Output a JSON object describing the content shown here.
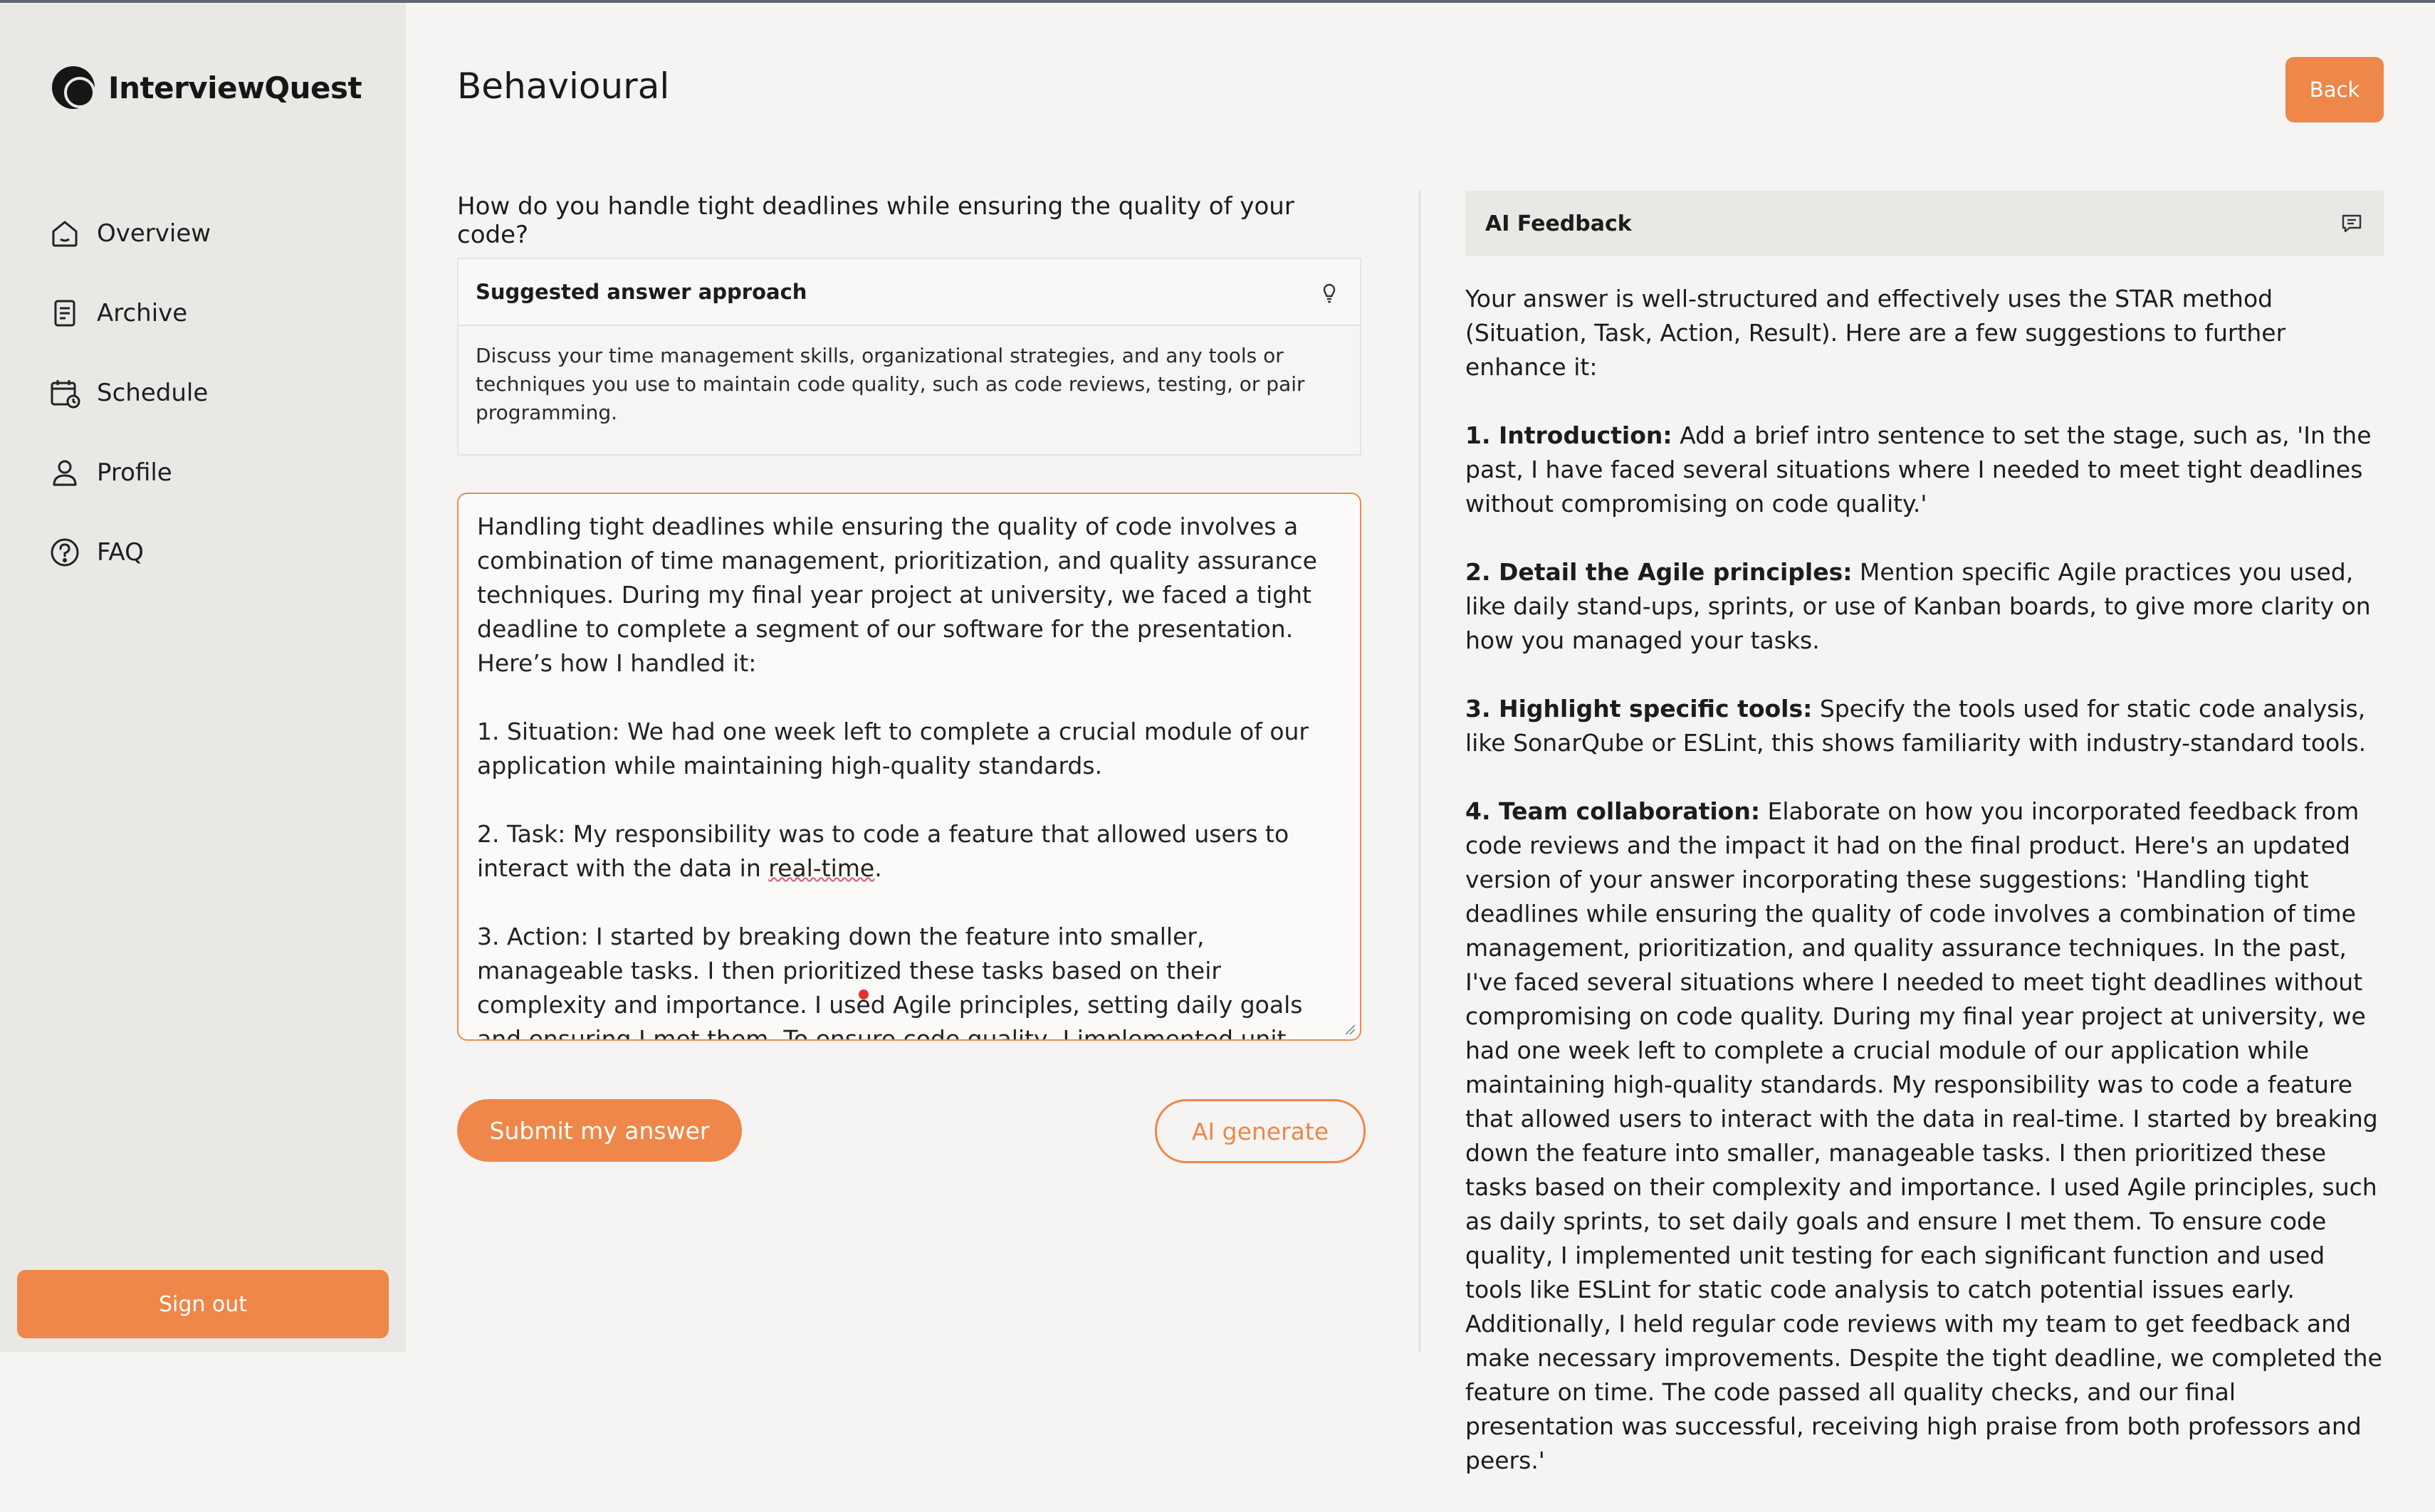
{
  "app": {
    "name": "InterviewQuest"
  },
  "sidebar": {
    "items": [
      {
        "label": "Overview",
        "icon": "home-icon"
      },
      {
        "label": "Archive",
        "icon": "document-icon"
      },
      {
        "label": "Schedule",
        "icon": "calendar-icon"
      },
      {
        "label": "Profile",
        "icon": "user-icon"
      },
      {
        "label": "FAQ",
        "icon": "help-circle-icon"
      }
    ],
    "signout_label": "Sign out"
  },
  "header": {
    "title": "Behavioural",
    "back_label": "Back"
  },
  "question": {
    "text": "How do you handle tight deadlines while ensuring the quality of your code?"
  },
  "approach": {
    "title": "Suggested answer approach",
    "text": "Discuss your time management skills, organizational strategies, and any tools or techniques you use to maintain code quality, such as code reviews, testing, or pair programming."
  },
  "answer": {
    "para1": "Handling tight deadlines while ensuring the quality of code involves a combination of time management, prioritization, and quality assurance techniques. During my final year project at university, we faced a tight deadline to complete a segment of our software for the presentation. Here’s how I handled it:",
    "para2": "1. Situation: We had one week left to complete a crucial module of our application while maintaining high-quality standards.",
    "para3_pre": "2. Task: My responsibility was to code a feature that allowed users to interact with the data in ",
    "para3_flag": "real-time",
    "para3_post": ".",
    "para4": "3. Action: I started by breaking down the feature into smaller, manageable tasks. I then prioritized these tasks based on their complexity and importance. I used Agile principles, setting daily goals and ensuring I met them. To ensure code quality, I implemented unit testing for each significant"
  },
  "actions": {
    "submit_label": "Submit my answer",
    "ai_label": "AI generate"
  },
  "feedback": {
    "title": "AI Feedback",
    "intro": "Your answer is well-structured and effectively uses the STAR method (Situation, Task, Action, Result). Here are a few suggestions to further enhance it:",
    "points": [
      {
        "heading": "1. Introduction:",
        "text": " Add a brief intro sentence to set the stage, such as, 'In the past, I have faced several situations where I needed to meet tight deadlines without compromising on code quality.'"
      },
      {
        "heading": "2. Detail the Agile principles:",
        "text": " Mention specific Agile practices you used, like daily stand-ups, sprints, or use of Kanban boards, to give more clarity on how you managed your tasks."
      },
      {
        "heading": "3. Highlight specific tools:",
        "text": " Specify the tools used for static code analysis, like SonarQube or ESLint, this shows familiarity with industry-standard tools."
      },
      {
        "heading": "4. Team collaboration:",
        "text": " Elaborate on how you incorporated feedback from code reviews and the impact it had on the final product. Here's an updated version of your answer incorporating these suggestions: 'Handling tight deadlines while ensuring the quality of code involves a combination of time management, prioritization, and quality assurance techniques. In the past, I've faced several situations where I needed to meet tight deadlines without compromising on code quality. During my final year project at university, we had one week left to complete a crucial module of our application while maintaining high-quality standards. My responsibility was to code a feature that allowed users to interact with the data in real-time. I started by breaking down the feature into smaller, manageable tasks. I then prioritized these tasks based on their complexity and importance. I used Agile principles, such as daily sprints, to set daily goals and ensure I met them. To ensure code quality, I implemented unit testing for each significant function and used tools like ESLint for static code analysis to catch potential issues early. Additionally, I held regular code reviews with my team to get feedback and make necessary improvements. Despite the tight deadline, we completed the feature on time. The code passed all quality checks, and our final presentation was successful, receiving high praise from both professors and peers.'"
      }
    ]
  },
  "colors": {
    "accent": "#ee8749",
    "sidebar_bg": "#e9e8e5",
    "page_bg": "#f5f4f2",
    "spell_underline": "#e0566b"
  }
}
